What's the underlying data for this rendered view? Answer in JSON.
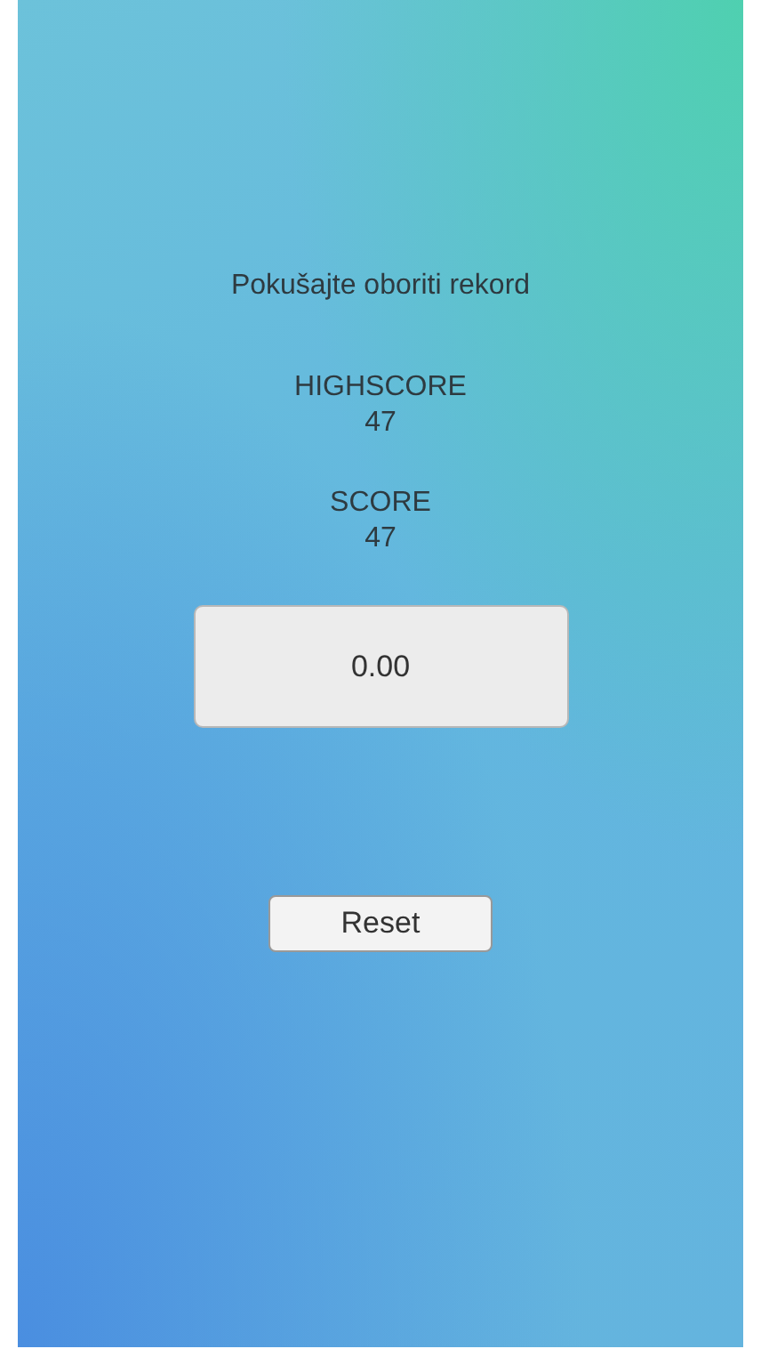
{
  "title": "Pokušajte oboriti rekord",
  "highscore": {
    "label": "HIGHSCORE",
    "value": "47"
  },
  "score": {
    "label": "SCORE",
    "value": "47"
  },
  "timer": {
    "value": "0.00"
  },
  "buttons": [
    {
      "label": "Reset"
    }
  ]
}
